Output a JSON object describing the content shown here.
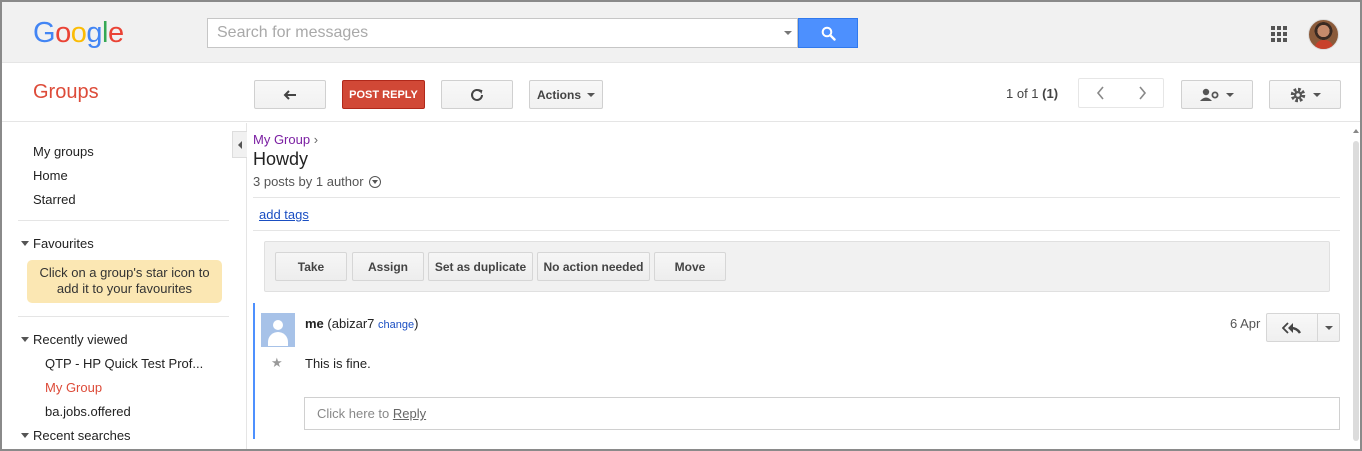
{
  "header": {
    "logo_letters": [
      {
        "ch": "G",
        "color": "#4285f4"
      },
      {
        "ch": "o",
        "color": "#ea4335"
      },
      {
        "ch": "o",
        "color": "#fbbc05"
      },
      {
        "ch": "g",
        "color": "#4285f4"
      },
      {
        "ch": "l",
        "color": "#34a853"
      },
      {
        "ch": "e",
        "color": "#ea4335"
      }
    ],
    "search_placeholder": "Search for messages"
  },
  "toolbar": {
    "app_title": "Groups",
    "post_reply_label": "POST REPLY",
    "actions_label": "Actions",
    "pager_text_prefix": "1 of 1 ",
    "pager_text_count": "(1)"
  },
  "sidebar": {
    "items": [
      "My groups",
      "Home",
      "Starred"
    ],
    "favourites_label": "Favourites",
    "favourites_note": "Click on a group's star icon to add it to your favourites",
    "recently_viewed_label": "Recently viewed",
    "recent": [
      "QTP - HP Quick Test Prof...",
      "My Group",
      "ba.jobs.offered"
    ],
    "recent_searches_label": "Recent searches"
  },
  "topic": {
    "breadcrumb_group": "My Group",
    "breadcrumb_sep": "›",
    "title": "Howdy",
    "posts_info": "3 posts by 1 author",
    "add_tags": "add tags"
  },
  "actions": {
    "buttons": [
      "Take",
      "Assign",
      "Set as duplicate",
      "No action needed",
      "Move"
    ]
  },
  "post": {
    "author": "me",
    "handle": "(abizar7",
    "change": "change",
    "handle_close": ")",
    "date": "6 Apr",
    "body": "This is fine.",
    "reply_prefix": "Click here to ",
    "reply_link": "Reply"
  },
  "colors": {
    "accent_red": "#dd4b39",
    "search_blue": "#4d90fe",
    "post_reply_red": "#d14836",
    "link_blue": "#1a4ec2",
    "breadcrumb_purple": "#7b1fa2",
    "favourites_note_bg": "#fbe7b3"
  }
}
